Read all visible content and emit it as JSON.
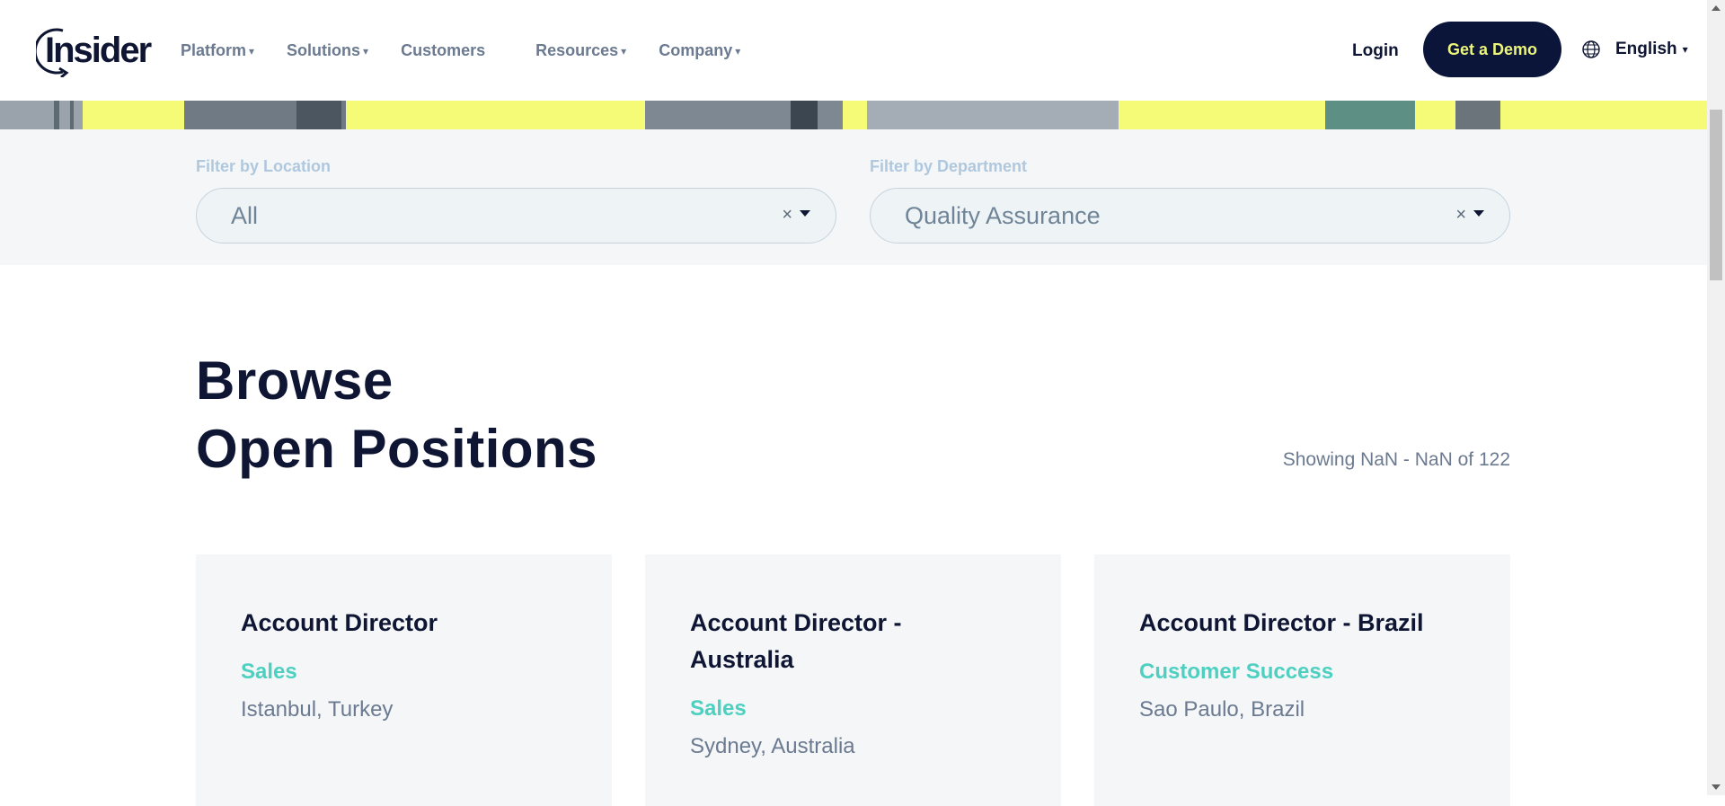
{
  "header": {
    "logo_text": "Insider",
    "nav": [
      {
        "label": "Platform",
        "caret": "▾"
      },
      {
        "label": "Solutions",
        "caret": "▾"
      },
      {
        "label": "Customers",
        "caret": ""
      },
      {
        "label": "Resources",
        "caret": "▾"
      },
      {
        "label": "Company",
        "caret": "▾"
      }
    ],
    "login_label": "Login",
    "demo_label": "Get a Demo",
    "language": "English",
    "language_caret": "▾"
  },
  "filters": {
    "location": {
      "label": "Filter by Location",
      "value": "All",
      "clear": "×"
    },
    "department": {
      "label": "Filter by Department",
      "value": "Quality Assurance",
      "clear": "×"
    }
  },
  "listing": {
    "title_line1": "Browse",
    "title_line2": "Open Positions",
    "showing": "Showing NaN - NaN of 122"
  },
  "jobs": [
    {
      "title": "Account Director",
      "department": "Sales",
      "location": "Istanbul, Turkey"
    },
    {
      "title": "Account Director - Australia",
      "department": "Sales",
      "location": "Sydney, Australia"
    },
    {
      "title": "Account Director - Brazil",
      "department": "Customer Success",
      "location": "Sao Paulo, Brazil"
    }
  ],
  "colors": {
    "brand_dark": "#0a1539",
    "demo_text": "#ecf57a",
    "accent_teal": "#4ed0c1",
    "hero_yellow": "#f6fb77"
  }
}
